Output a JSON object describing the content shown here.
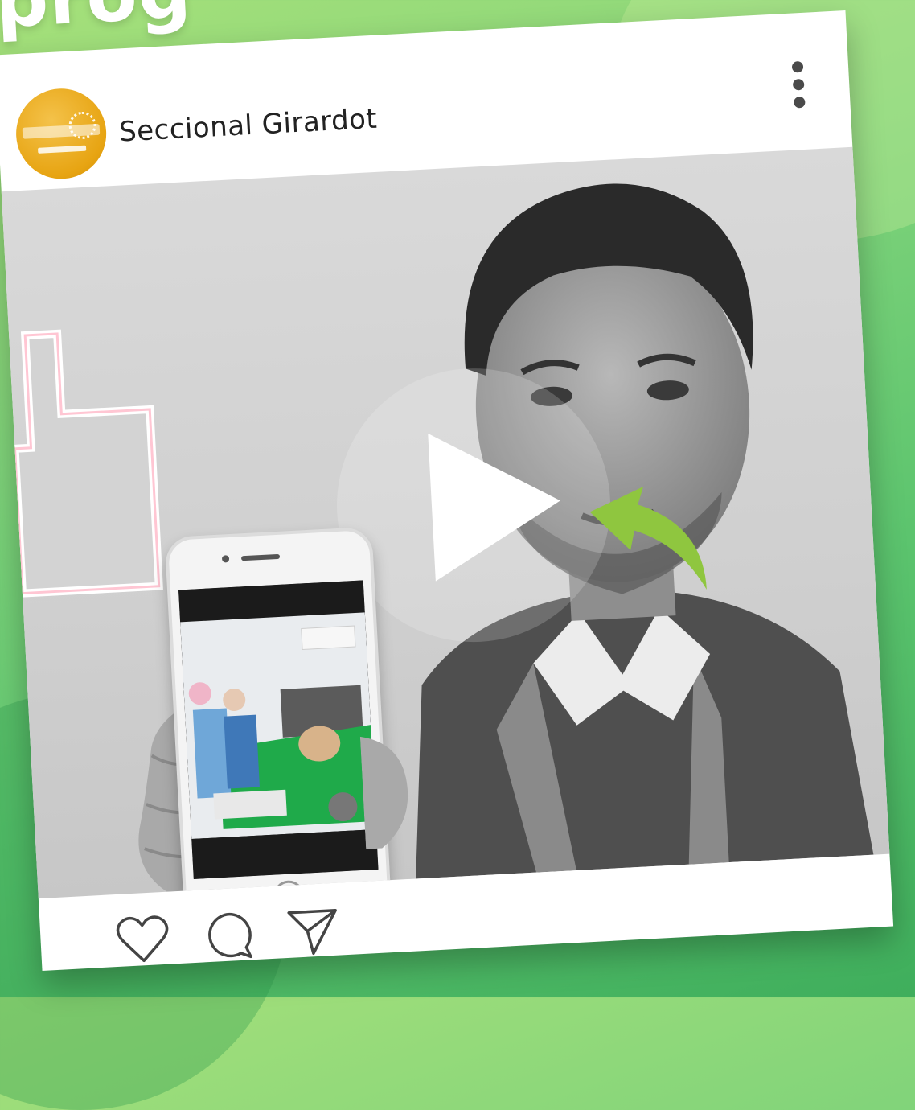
{
  "headline": "prog",
  "post": {
    "account_name": "Seccional Girardot",
    "avatar": {
      "kind": "logo",
      "colors": [
        "#e7a412",
        "#ffffff"
      ]
    },
    "more_icon": "more-vertical-icon",
    "media": {
      "play_icon": "play-icon",
      "overlay_arrow_icon": "curved-arrow-icon",
      "like_icon": "thumbs-up-icon",
      "accent_green": "#8fc63f"
    },
    "actions": [
      {
        "icon": "heart-icon"
      },
      {
        "icon": "comment-icon"
      },
      {
        "icon": "send-icon"
      }
    ]
  },
  "colors": {
    "background_top": "#a6e07a",
    "background_bottom": "#3fae5c",
    "card": "#ffffff"
  }
}
